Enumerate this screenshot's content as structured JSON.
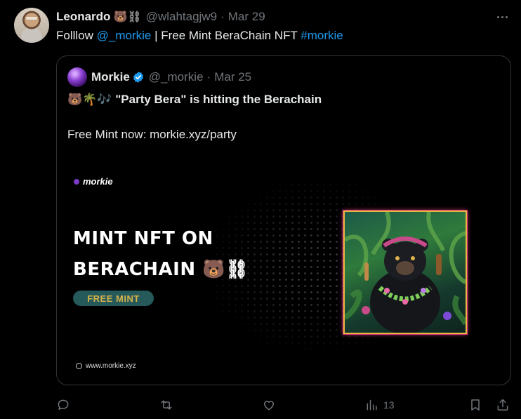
{
  "tweet": {
    "author_name": "Leonardo",
    "author_emoji": "🐻⛓",
    "handle": "@wlahtagjw9",
    "separator": "·",
    "date": "Mar 29",
    "text_prefix": "Folllow ",
    "mention": "@_morkie",
    "text_middle": " | Free Mint BeraChain NFT ",
    "hashtag": "#morkie"
  },
  "quote": {
    "author_name": "Morkie",
    "handle": "@_morkie",
    "separator": "·",
    "date": "Mar 25",
    "line1": "🐻🌴🎶 \"Party Bera\" is hitting the Berachain",
    "line2": "Free Mint now:  morkie.xyz/party",
    "media": {
      "logo_text": "morkie",
      "headline_1": "MINT NFT ON",
      "headline_2": "BERACHAIN 🐻⛓",
      "cta_label": "FREE MINT",
      "site_text": "www.morkie.xyz"
    }
  },
  "actions": {
    "reply_icon": "reply-icon",
    "retweet_icon": "retweet-icon",
    "like_icon": "heart-icon",
    "views_icon": "views-icon",
    "views_count": "13",
    "bookmark_icon": "bookmark-icon",
    "share_icon": "share-icon"
  },
  "colors": {
    "background": "#000000",
    "text": "#e7e9ea",
    "muted": "#71767b",
    "link": "#1d9bf0",
    "border": "#2f3336",
    "verified": "#1d9bf0",
    "cta_bg": "#25595a",
    "cta_text": "#d8b24a"
  }
}
